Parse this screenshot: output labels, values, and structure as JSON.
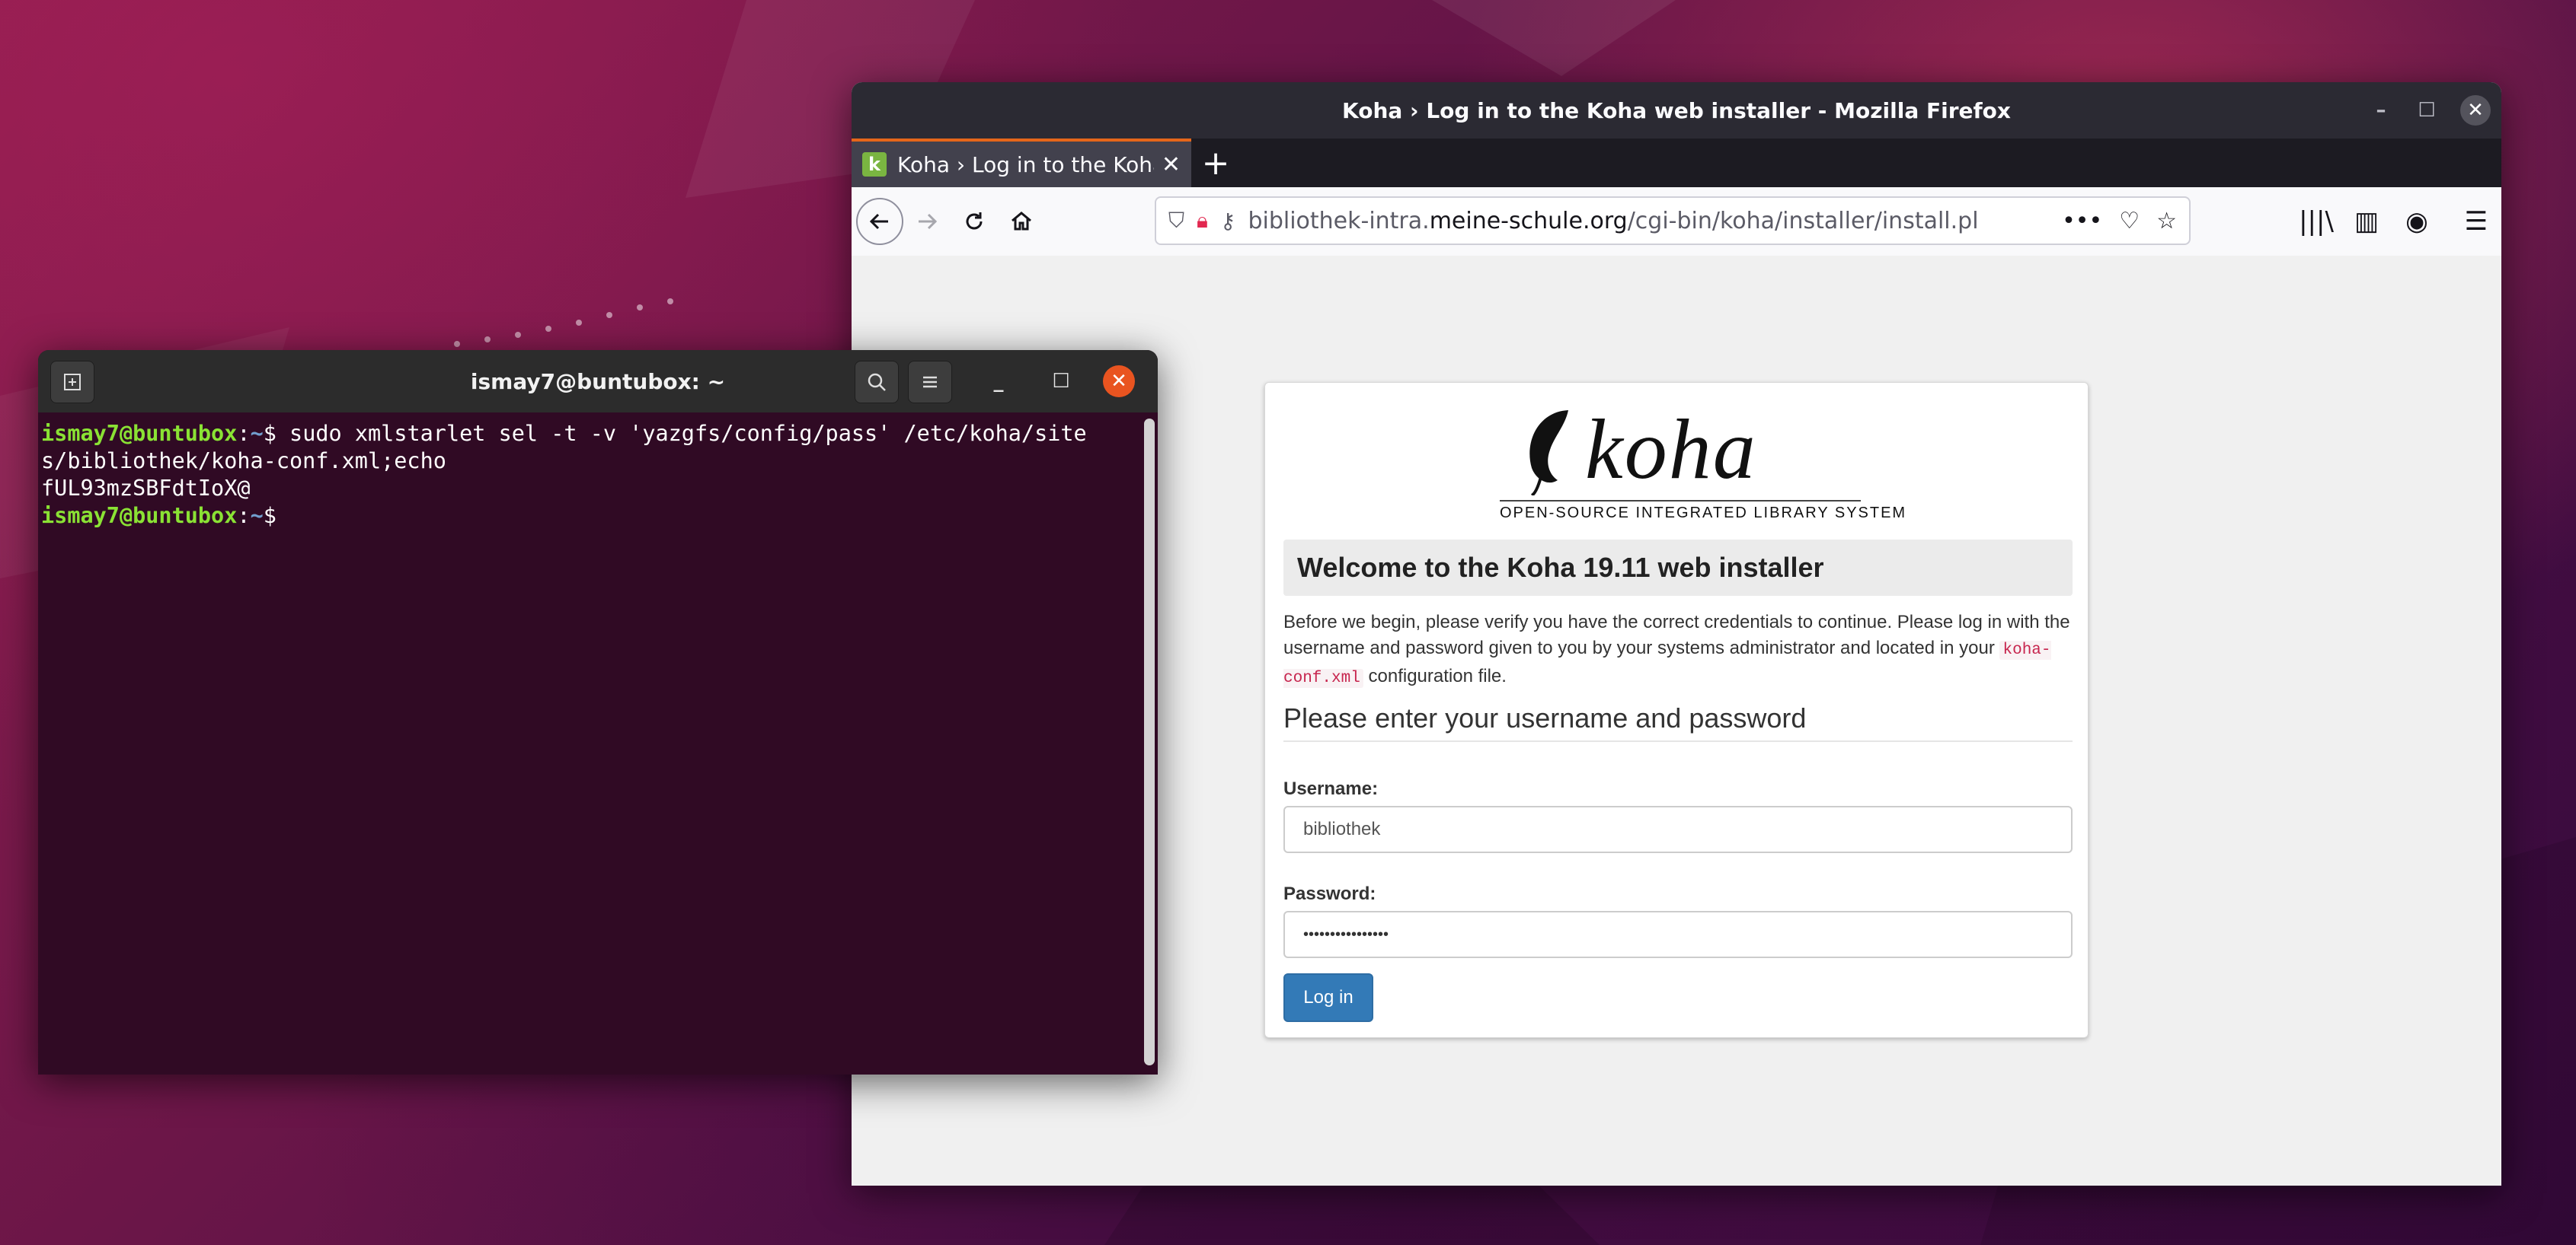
{
  "firefox": {
    "window_title": "Koha › Log in to the Koha web installer - Mozilla Firefox",
    "tab": {
      "title": "Koha › Log in to the Koha web installer",
      "favicon_letter": "k"
    },
    "url": {
      "prefix": "bibliothek-intra.",
      "host": "meine-schule.org",
      "path": "/cgi-bin/koha/installer/install.pl"
    },
    "page": {
      "logo_text": "koha",
      "logo_tagline": "OPEN-SOURCE INTEGRATED LIBRARY SYSTEM",
      "welcome_title": "Welcome to the Koha 19.11 web installer",
      "intro_before": "Before we begin, please verify you have the correct credentials to continue. Please log in with the username and password given to you by your systems administrator and located in your",
      "intro_code": "koha-conf.xml",
      "intro_after": "configuration file.",
      "form_heading": "Please enter your username and password",
      "username_label": "Username:",
      "username_value": "bibliothek",
      "password_label": "Password:",
      "password_value": "••••••••••••••••",
      "login_button": "Log in"
    }
  },
  "terminal": {
    "title": "ismay7@buntubox: ~",
    "prompt_user": "ismay7@buntubox",
    "prompt_path": "~",
    "command_line1": "$ sudo xmlstarlet sel -t -v 'yazgfs/config/pass' /etc/koha/site",
    "command_line2": "s/bibliothek/koha-conf.xml;echo",
    "output_line": "fUL93mzSBFdtIoX@",
    "prompt_end": "$"
  },
  "colors": {
    "ubuntu_orange": "#e95420",
    "terminal_bg": "#300a24",
    "firefox_tab_accent": "#e5661a",
    "koha_button": "#337ab7"
  }
}
